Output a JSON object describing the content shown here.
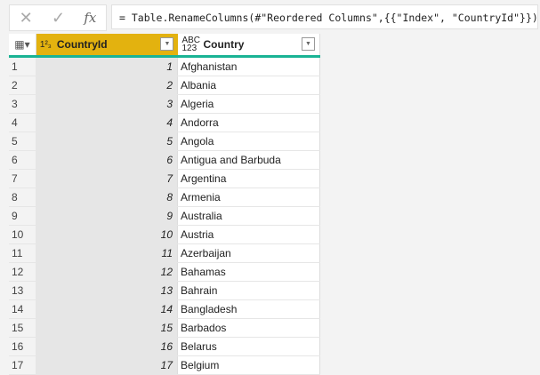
{
  "formula_bar": {
    "cancel_icon": "✕",
    "confirm_icon": "✓",
    "fx_label": "fx",
    "formula": "= Table.RenameColumns(#\"Reordered Columns\",{{\"Index\", \"CountryId\"}})"
  },
  "columns": [
    {
      "type": "1²₃",
      "name": "CountryId"
    },
    {
      "type": "ABC 123",
      "name": "Country"
    }
  ],
  "rows": [
    {
      "n": "1",
      "id": "1",
      "country": "Afghanistan"
    },
    {
      "n": "2",
      "id": "2",
      "country": "Albania"
    },
    {
      "n": "3",
      "id": "3",
      "country": "Algeria"
    },
    {
      "n": "4",
      "id": "4",
      "country": "Andorra"
    },
    {
      "n": "5",
      "id": "5",
      "country": "Angola"
    },
    {
      "n": "6",
      "id": "6",
      "country": "Antigua and Barbuda"
    },
    {
      "n": "7",
      "id": "7",
      "country": "Argentina"
    },
    {
      "n": "8",
      "id": "8",
      "country": "Armenia"
    },
    {
      "n": "9",
      "id": "9",
      "country": "Australia"
    },
    {
      "n": "10",
      "id": "10",
      "country": "Austria"
    },
    {
      "n": "11",
      "id": "11",
      "country": "Azerbaijan"
    },
    {
      "n": "12",
      "id": "12",
      "country": "Bahamas"
    },
    {
      "n": "13",
      "id": "13",
      "country": "Bahrain"
    },
    {
      "n": "14",
      "id": "14",
      "country": "Bangladesh"
    },
    {
      "n": "15",
      "id": "15",
      "country": "Barbados"
    },
    {
      "n": "16",
      "id": "16",
      "country": "Belarus"
    },
    {
      "n": "17",
      "id": "17",
      "country": "Belgium"
    }
  ]
}
